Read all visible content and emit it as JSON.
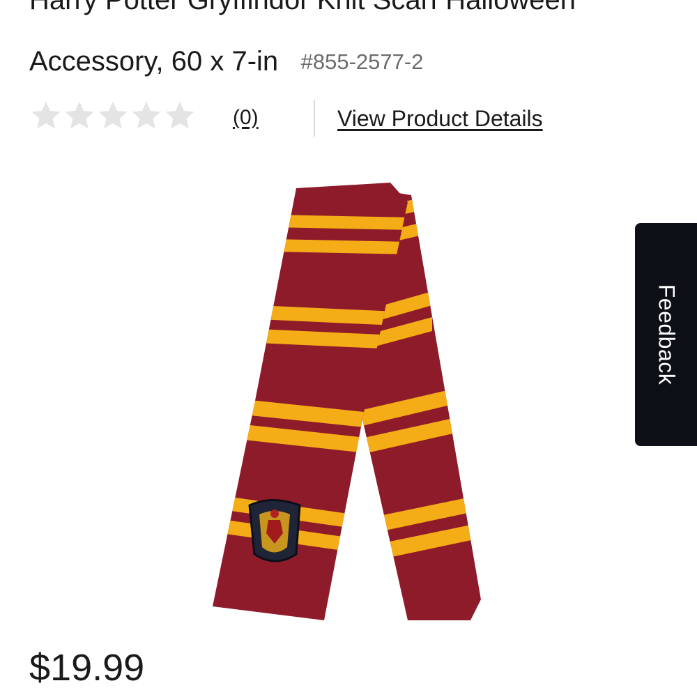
{
  "product": {
    "title_line1": "Harry Potter Gryffindor Knit Scarf Halloween",
    "title_line2": "Accessory, 60 x 7-in",
    "sku": "#855-2577-2",
    "rating": {
      "stars_filled": 0,
      "stars_total": 5,
      "review_count_label": "(0)"
    },
    "details_link": "View Product Details",
    "price": "$19.99"
  },
  "feedback": {
    "label": "Feedback"
  },
  "colors": {
    "scarf_maroon": "#8e1b2a",
    "scarf_gold": "#f4ad16",
    "star_empty": "#e4e4e4",
    "feedback_bg": "#0d0f16"
  }
}
